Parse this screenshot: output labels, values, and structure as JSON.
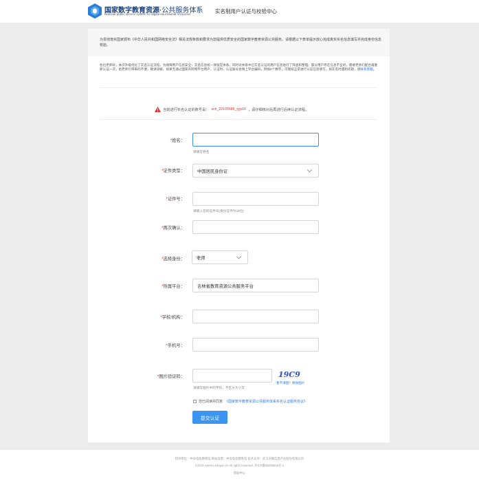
{
  "header": {
    "brand_cn_main": "国家数字教育资源",
    "brand_cn_sep": "·",
    "brand_cn_sub": "公共服务体系",
    "brand_en": "National public service system for digital educational resources",
    "title": "实名制用户认证与校验中心",
    "accent_color": "#2b7ed8"
  },
  "notice": "为贯彻落实国家颁布《中华人民共和国网络安全法》相关法规条款和要求为您提供优质安全的国家数字教育资源公共服务。请根据以下表单提示放心完成真实实名信息填写并完成身份信息校验。",
  "intro": {
    "text": "各位老师好，本次升级优化了实名认证流程。为保障用户信息安全，实名信息统一保留在体系，同时对体系中已实名认证的用户信息进行了筛查和整理。部分用户存在信息不全的，需要老师们配合再重新认证一次，给老师们带来的不便，敬请谅解。如果无通过国家的跨网平台用户，认证时，认证账号会填上平台编码，例如6个数字，可继续正常进行认证信息填写。如实名时遇到问题，请",
    "link": "联系客服",
    "end": "。"
  },
  "warning": {
    "prefix": "当前进行实名认证的账号是：",
    "account": "sch_22105586_tyjs10",
    "suffix": "，请仔细核对后再进行后续认证流程。"
  },
  "form": {
    "name": {
      "label": "姓名：",
      "value": "",
      "hint": "请填写姓名"
    },
    "id_type": {
      "label": "证件类型：",
      "value": "中国居民身份证"
    },
    "id_number": {
      "label": "证件号：",
      "value": "",
      "hint": "请输入您的证件号(身份证件为18位)"
    },
    "confirm": {
      "label": "再次确认：",
      "value": ""
    },
    "role": {
      "label": "选择身份：",
      "value": "老师"
    },
    "platform": {
      "label": "所属平台：",
      "value": "吉林省教育资源公共服务平台"
    },
    "school": {
      "label": "学校/机构：",
      "value": ""
    },
    "phone": {
      "label": "手机号：",
      "value": ""
    },
    "captcha": {
      "label": "图片验证码：",
      "value": "",
      "hint": "请填写图片中的字符，不区分大小写",
      "image_text": "19C9",
      "refresh": "看不清楚？换张图片"
    },
    "required_mark": "*"
  },
  "agreement": {
    "prefix": "您已阅读并同意",
    "link": "《国家数字教育资源公共服务体系实名认证服务协议》"
  },
  "submit_label": "提交认证",
  "footer": {
    "line1": "指导单位：中央电化教育馆    网站运营：中央电化教育馆    技术支持：武汉天喻信息产业股份有限公司",
    "line2": "©2019 sytems.eduyun.cn All rights reserved.    京ICP备05005516号-1",
    "line3": "帮助中心"
  }
}
